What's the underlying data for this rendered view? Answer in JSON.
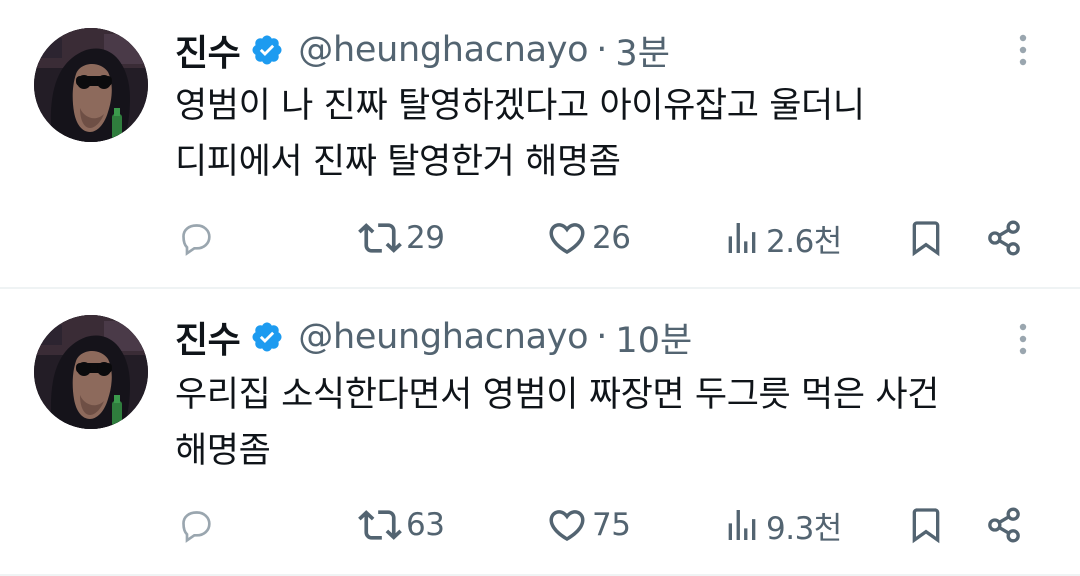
{
  "colors": {
    "text_primary": "#0f1419",
    "text_secondary": "#536471",
    "verified_blue": "#1d9bf0",
    "divider": "#eff3f4"
  },
  "tweets": [
    {
      "author_name": "진수",
      "verified": true,
      "handle": "@heunghacnayo",
      "separator": "·",
      "time": "3분",
      "body_lines": [
        "영범이 나 진짜 탈영하겠다고 아이유잡고 울더니",
        "디피에서 진짜 탈영한거 해명좀"
      ],
      "retweets": "29",
      "likes": "26",
      "views": "2.6천",
      "icons": [
        "reply-icon",
        "retweet-icon",
        "like-icon",
        "views-icon",
        "bookmark-icon",
        "share-icon",
        "more-icon"
      ]
    },
    {
      "author_name": "진수",
      "verified": true,
      "handle": "@heunghacnayo",
      "separator": "·",
      "time": "10분",
      "body_lines": [
        "우리집 소식한다면서 영범이 짜장면 두그릇 먹은 사건",
        "해명좀"
      ],
      "retweets": "63",
      "likes": "75",
      "views": "9.3천",
      "icons": [
        "reply-icon",
        "retweet-icon",
        "like-icon",
        "views-icon",
        "bookmark-icon",
        "share-icon",
        "more-icon"
      ]
    }
  ]
}
